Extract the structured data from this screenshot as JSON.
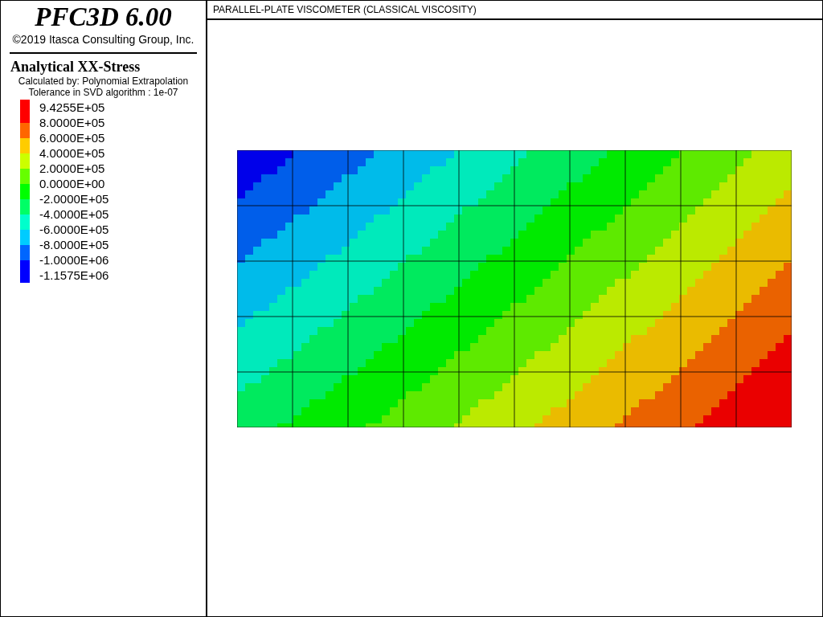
{
  "legend": {
    "product": "PFC3D 6.00",
    "copyright": "©2019 Itasca Consulting Group, Inc.",
    "title": "Analytical XX-Stress",
    "notes": [
      "Calculated by: Polynomial Extrapolation",
      "Tolerance in SVD algorithm : 1e-07"
    ],
    "labels": [
      "9.4255E+05",
      "8.0000E+05",
      "6.0000E+05",
      "4.0000E+05",
      "2.0000E+05",
      "0.0000E+00",
      "-2.0000E+05",
      "-4.0000E+05",
      "-6.0000E+05",
      "-8.0000E+05",
      "-1.0000E+06",
      "-1.1575E+06"
    ],
    "bands": [
      {
        "color": "#ff0000"
      },
      {
        "color": "#ff6600"
      },
      {
        "color": "#ffcc00"
      },
      {
        "color": "#ccff00"
      },
      {
        "color": "#66ff00"
      },
      {
        "color": "#00ff00"
      },
      {
        "color": "#00ff66"
      },
      {
        "color": "#00ffcc"
      },
      {
        "color": "#00ccff"
      },
      {
        "color": "#0066ff"
      },
      {
        "color": "#0000ff"
      }
    ]
  },
  "view": {
    "title": "PARALLEL-PLATE VISCOMETER (CLASSICAL VISCOSITY)"
  }
}
